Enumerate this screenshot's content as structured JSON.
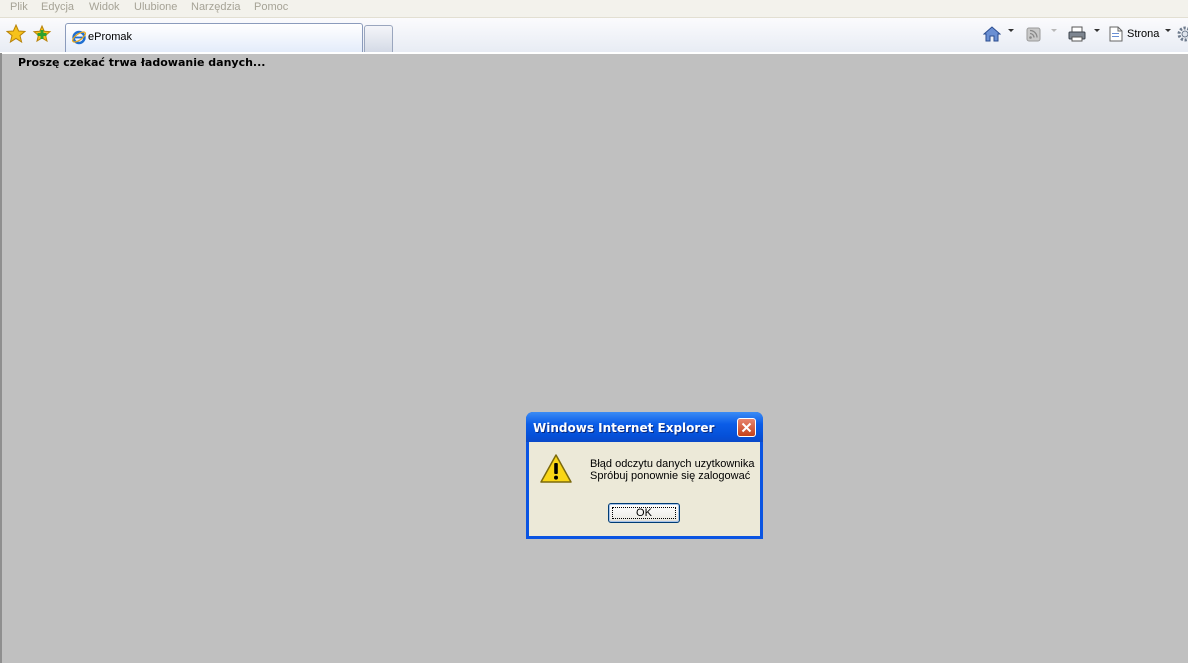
{
  "menu": {
    "items": [
      "Plik",
      "Edycja",
      "Widok",
      "Ulubione",
      "Narzędzia",
      "Pomoc"
    ]
  },
  "tab": {
    "title": "ePromak"
  },
  "toolbar": {
    "page_label": "Strona"
  },
  "page": {
    "loading_text": "Proszę czekać trwa ładowanie danych..."
  },
  "dialog": {
    "title": "Windows Internet Explorer",
    "line1": "Błąd odczytu danych uzytkownika",
    "line2": "Spróbuj ponownie się zalogować",
    "ok_label": "OK"
  },
  "colors": {
    "page_bg": "#c0c0c0",
    "dialog_title": "#0a54e2",
    "dialog_body": "#ece9d8"
  },
  "icons": [
    "favorites-star-icon",
    "add-favorites-icon",
    "ie-logo-icon",
    "home-icon",
    "rss-feed-icon",
    "print-icon",
    "page-icon",
    "tools-gear-icon",
    "close-icon",
    "warning-icon"
  ]
}
